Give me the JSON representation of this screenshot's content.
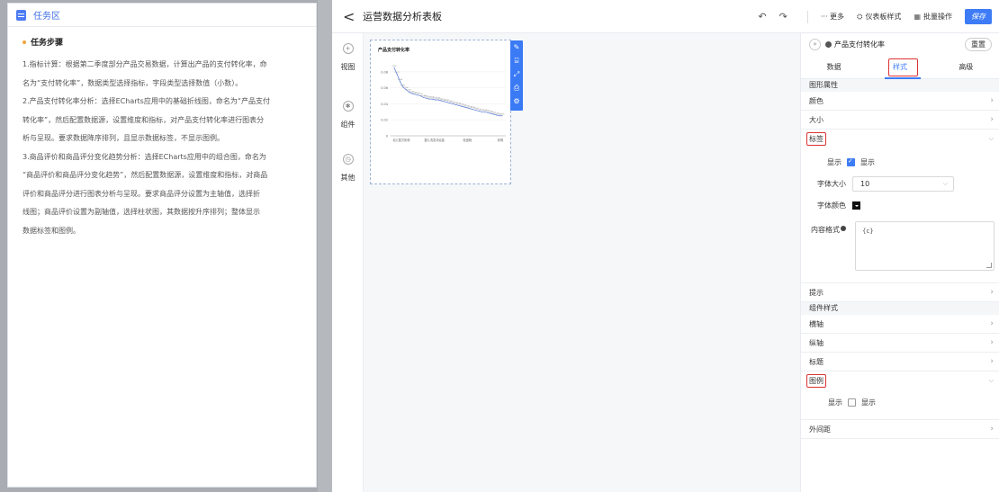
{
  "task_panel": {
    "title": "任务区",
    "steps_title": "任务步骤",
    "lines": [
      "1.指标计算：根据第二季度部分产品交易数据，计算出产品的支付转化率，命",
      "名为“支付转化率”，数据类型选择指标，字段类型选择数值（小数）。",
      "2.产品支付转化率分析：选择ECharts应用中的基础折线图，命名为“产品支付",
      "转化率”，然后配置数据源，设置维度和指标，对产品支付转化率进行图表分",
      "析与呈现。要求数据降序排列，且显示数据标签，不显示图例。",
      "3.商品评价和商品评分变化趋势分析：选择ECharts应用中的组合图，命名为",
      "“商品评价和商品评分变化趋势”，然后配置数据源，设置维度和指标，对商品",
      "评价和商品评分进行图表分析与呈现。要求商品评分设置为主轴值，选择折",
      "线图；商品评价设置为副轴值，选择柱状图，其数据按升序排列；整体显示",
      "数据标签和图例。"
    ]
  },
  "topbar": {
    "back": "<",
    "title": "运营数据分析表板",
    "undo": "↶",
    "redo": "↷",
    "more": "··· 更多",
    "dashboard_style": "仪表板样式",
    "batch_ops": "批量操作",
    "save": "保存"
  },
  "rail": {
    "view": "视图",
    "component": "组件",
    "other": "其他"
  },
  "chart": {
    "title": "产品支付转化率",
    "y_ticks": [
      "0.08",
      "0.06",
      "0.04",
      "0.02",
      "0"
    ],
    "x_ticks": [
      "幼儿配方奶粉",
      "婴儿洗发沐浴露",
      "吸盘碗",
      "奶嘴"
    ]
  },
  "chart_data": {
    "type": "line",
    "title": "产品支付转化率",
    "ylim": [
      0,
      0.09
    ],
    "y_ticks": [
      0,
      0.02,
      0.04,
      0.06,
      0.08
    ],
    "x_tick_labels": [
      "幼儿配方奶粉",
      "婴儿洗发沐浴露",
      "吸盘碗",
      "奶嘴"
    ],
    "values": [
      0.085,
      0.077,
      0.068,
      0.061,
      0.058,
      0.055,
      0.053,
      0.052,
      0.051,
      0.05,
      0.048,
      0.047,
      0.046,
      0.046,
      0.045,
      0.045,
      0.044,
      0.043,
      0.042,
      0.041,
      0.04,
      0.039,
      0.038,
      0.037,
      0.036,
      0.035,
      0.034,
      0.033,
      0.032,
      0.031,
      0.03,
      0.03,
      0.029,
      0.028,
      0.027,
      0.026,
      0.025,
      0.025
    ],
    "grid": true,
    "legend": "none"
  },
  "props": {
    "header_title": "产品支付转化率",
    "reset": "重置",
    "tabs": [
      "数据",
      "样式",
      "高级"
    ],
    "group_shape": "图形属性",
    "color": "颜色",
    "size": "大小",
    "label": "标签",
    "show": "显示",
    "show_option": "显示",
    "font_size_label": "字体大小",
    "font_size_value": "10",
    "font_color_label": "字体颜色",
    "content_format_label": "内容格式",
    "content_format_value": "{c}",
    "tooltip": "提示",
    "group_component": "组件样式",
    "x_axis": "横轴",
    "y_axis": "纵轴",
    "title": "标题",
    "legend": "图例",
    "legend_show": "显示",
    "legend_show_option": "显示",
    "margin": "外间距"
  }
}
